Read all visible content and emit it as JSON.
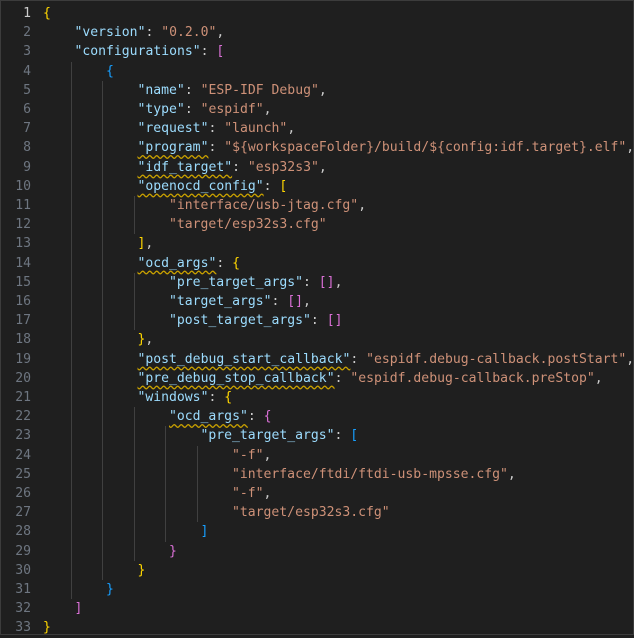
{
  "editor": {
    "active_line": 1,
    "lines": [
      {
        "n": "1",
        "indent": 0,
        "tokens": [
          {
            "t": "{",
            "c": "b1"
          }
        ]
      },
      {
        "n": "2",
        "indent": 1,
        "tokens": [
          {
            "t": "\"version\"",
            "c": "k"
          },
          {
            "t": ": ",
            "c": "p"
          },
          {
            "t": "\"0.2.0\"",
            "c": "s"
          },
          {
            "t": ",",
            "c": "p"
          }
        ]
      },
      {
        "n": "3",
        "indent": 1,
        "tokens": [
          {
            "t": "\"configurations\"",
            "c": "k"
          },
          {
            "t": ": ",
            "c": "p"
          },
          {
            "t": "[",
            "c": "b2"
          }
        ]
      },
      {
        "n": "4",
        "indent": 2,
        "tokens": [
          {
            "t": "{",
            "c": "b3"
          }
        ]
      },
      {
        "n": "5",
        "indent": 3,
        "tokens": [
          {
            "t": "\"name\"",
            "c": "k"
          },
          {
            "t": ": ",
            "c": "p"
          },
          {
            "t": "\"ESP-IDF Debug\"",
            "c": "s"
          },
          {
            "t": ",",
            "c": "p"
          }
        ]
      },
      {
        "n": "6",
        "indent": 3,
        "tokens": [
          {
            "t": "\"type\"",
            "c": "k"
          },
          {
            "t": ": ",
            "c": "p"
          },
          {
            "t": "\"espidf\"",
            "c": "s"
          },
          {
            "t": ",",
            "c": "p"
          }
        ]
      },
      {
        "n": "7",
        "indent": 3,
        "tokens": [
          {
            "t": "\"request\"",
            "c": "k"
          },
          {
            "t": ": ",
            "c": "p"
          },
          {
            "t": "\"launch\"",
            "c": "s"
          },
          {
            "t": ",",
            "c": "p"
          }
        ]
      },
      {
        "n": "8",
        "indent": 3,
        "tokens": [
          {
            "t": "\"program\"",
            "c": "k",
            "sq": true
          },
          {
            "t": ": ",
            "c": "p"
          },
          {
            "t": "\"${workspaceFolder}/build/${config:idf.target}.elf\"",
            "c": "s"
          },
          {
            "t": ",",
            "c": "p"
          }
        ]
      },
      {
        "n": "9",
        "indent": 3,
        "tokens": [
          {
            "t": "\"idf_target\"",
            "c": "k",
            "sq": true
          },
          {
            "t": ": ",
            "c": "p"
          },
          {
            "t": "\"esp32s3\"",
            "c": "s"
          },
          {
            "t": ",",
            "c": "p"
          }
        ]
      },
      {
        "n": "10",
        "indent": 3,
        "tokens": [
          {
            "t": "\"openocd_config\"",
            "c": "k",
            "sq": true
          },
          {
            "t": ": ",
            "c": "p"
          },
          {
            "t": "[",
            "c": "b1"
          }
        ]
      },
      {
        "n": "11",
        "indent": 4,
        "tokens": [
          {
            "t": "\"interface/usb-jtag.cfg\"",
            "c": "s"
          },
          {
            "t": ",",
            "c": "p"
          }
        ]
      },
      {
        "n": "12",
        "indent": 4,
        "tokens": [
          {
            "t": "\"target/esp32s3.cfg\"",
            "c": "s"
          }
        ]
      },
      {
        "n": "13",
        "indent": 3,
        "tokens": [
          {
            "t": "]",
            "c": "b1"
          },
          {
            "t": ",",
            "c": "p"
          }
        ]
      },
      {
        "n": "14",
        "indent": 3,
        "tokens": [
          {
            "t": "\"ocd_args\"",
            "c": "k",
            "sq": true
          },
          {
            "t": ": ",
            "c": "p"
          },
          {
            "t": "{",
            "c": "b1"
          }
        ]
      },
      {
        "n": "15",
        "indent": 4,
        "tokens": [
          {
            "t": "\"pre_target_args\"",
            "c": "k"
          },
          {
            "t": ": ",
            "c": "p"
          },
          {
            "t": "[]",
            "c": "b2"
          },
          {
            "t": ",",
            "c": "p"
          }
        ]
      },
      {
        "n": "16",
        "indent": 4,
        "tokens": [
          {
            "t": "\"target_args\"",
            "c": "k"
          },
          {
            "t": ": ",
            "c": "p"
          },
          {
            "t": "[]",
            "c": "b2"
          },
          {
            "t": ",",
            "c": "p"
          }
        ]
      },
      {
        "n": "17",
        "indent": 4,
        "tokens": [
          {
            "t": "\"post_target_args\"",
            "c": "k"
          },
          {
            "t": ": ",
            "c": "p"
          },
          {
            "t": "[]",
            "c": "b2"
          }
        ]
      },
      {
        "n": "18",
        "indent": 3,
        "tokens": [
          {
            "t": "}",
            "c": "b1"
          },
          {
            "t": ",",
            "c": "p"
          }
        ]
      },
      {
        "n": "19",
        "indent": 3,
        "tokens": [
          {
            "t": "\"post_debug_start_callback\"",
            "c": "k",
            "sq": true
          },
          {
            "t": ": ",
            "c": "p"
          },
          {
            "t": "\"espidf.debug-callback.postStart\"",
            "c": "s"
          },
          {
            "t": ",",
            "c": "p"
          }
        ]
      },
      {
        "n": "20",
        "indent": 3,
        "tokens": [
          {
            "t": "\"pre_debug_stop_callback\"",
            "c": "k",
            "sq": true
          },
          {
            "t": ": ",
            "c": "p"
          },
          {
            "t": "\"espidf.debug-callback.preStop\"",
            "c": "s"
          },
          {
            "t": ",",
            "c": "p"
          }
        ]
      },
      {
        "n": "21",
        "indent": 3,
        "tokens": [
          {
            "t": "\"windows\"",
            "c": "k"
          },
          {
            "t": ": ",
            "c": "p"
          },
          {
            "t": "{",
            "c": "b1"
          }
        ]
      },
      {
        "n": "22",
        "indent": 4,
        "tokens": [
          {
            "t": "\"ocd_args\"",
            "c": "k",
            "sq": true
          },
          {
            "t": ": ",
            "c": "p"
          },
          {
            "t": "{",
            "c": "b2"
          }
        ]
      },
      {
        "n": "23",
        "indent": 5,
        "tokens": [
          {
            "t": "\"pre_target_args\"",
            "c": "k"
          },
          {
            "t": ": ",
            "c": "p"
          },
          {
            "t": "[",
            "c": "b3"
          }
        ]
      },
      {
        "n": "24",
        "indent": 6,
        "tokens": [
          {
            "t": "\"-f\"",
            "c": "s"
          },
          {
            "t": ",",
            "c": "p"
          }
        ]
      },
      {
        "n": "25",
        "indent": 6,
        "tokens": [
          {
            "t": "\"interface/ftdi/ftdi-usb-mpsse.cfg\"",
            "c": "s"
          },
          {
            "t": ",",
            "c": "p"
          }
        ]
      },
      {
        "n": "26",
        "indent": 6,
        "tokens": [
          {
            "t": "\"-f\"",
            "c": "s"
          },
          {
            "t": ",",
            "c": "p"
          }
        ]
      },
      {
        "n": "27",
        "indent": 6,
        "tokens": [
          {
            "t": "\"target/esp32s3.cfg\"",
            "c": "s"
          }
        ]
      },
      {
        "n": "28",
        "indent": 5,
        "tokens": [
          {
            "t": "]",
            "c": "b3"
          }
        ]
      },
      {
        "n": "29",
        "indent": 4,
        "tokens": [
          {
            "t": "}",
            "c": "b2"
          }
        ]
      },
      {
        "n": "30",
        "indent": 3,
        "tokens": [
          {
            "t": "}",
            "c": "b1"
          }
        ]
      },
      {
        "n": "31",
        "indent": 2,
        "tokens": [
          {
            "t": "}",
            "c": "b3"
          }
        ]
      },
      {
        "n": "32",
        "indent": 1,
        "tokens": [
          {
            "t": "]",
            "c": "b2"
          }
        ]
      },
      {
        "n": "33",
        "indent": 0,
        "tokens": [
          {
            "t": "}",
            "c": "b1"
          }
        ]
      }
    ]
  },
  "colors": {
    "key": "#9cdcfe",
    "string": "#ce9178",
    "punctuation": "#cccccc",
    "bracket_level_1": "#ffd700",
    "bracket_level_2": "#da70d6",
    "bracket_level_3": "#179fff",
    "warning_squiggle": "#c8a000",
    "background": "#1f1f1f"
  }
}
